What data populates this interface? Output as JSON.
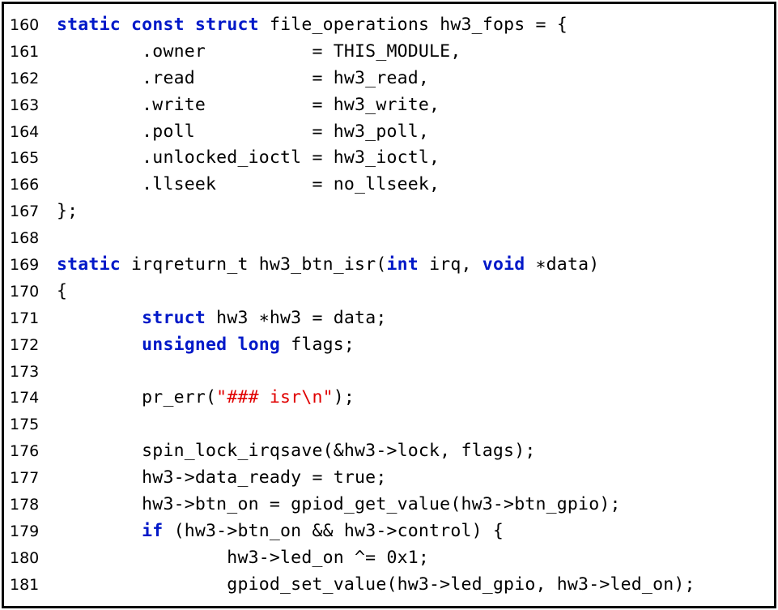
{
  "colors": {
    "keyword": "#0018c8",
    "string": "#e00000",
    "text": "#000000",
    "border": "#000000",
    "background": "#ffffff"
  },
  "lines": [
    {
      "num": "160",
      "tokens": [
        {
          "t": "static",
          "k": "kw"
        },
        {
          "t": " "
        },
        {
          "t": "const",
          "k": "kw"
        },
        {
          "t": " "
        },
        {
          "t": "struct",
          "k": "kw"
        },
        {
          "t": " file_operations hw3_fops = {"
        }
      ]
    },
    {
      "num": "161",
      "tokens": [
        {
          "t": "        .owner          = THIS_MODULE,"
        }
      ]
    },
    {
      "num": "162",
      "tokens": [
        {
          "t": "        .read           = hw3_read,"
        }
      ]
    },
    {
      "num": "163",
      "tokens": [
        {
          "t": "        .write          = hw3_write,"
        }
      ]
    },
    {
      "num": "164",
      "tokens": [
        {
          "t": "        .poll           = hw3_poll,"
        }
      ]
    },
    {
      "num": "165",
      "tokens": [
        {
          "t": "        .unlocked_ioctl = hw3_ioctl,"
        }
      ]
    },
    {
      "num": "166",
      "tokens": [
        {
          "t": "        .llseek         = no_llseek,"
        }
      ]
    },
    {
      "num": "167",
      "tokens": [
        {
          "t": "};"
        }
      ]
    },
    {
      "num": "168",
      "tokens": []
    },
    {
      "num": "169",
      "tokens": [
        {
          "t": "static",
          "k": "kw"
        },
        {
          "t": " irqreturn_t hw3_btn_isr("
        },
        {
          "t": "int",
          "k": "kw"
        },
        {
          "t": " irq, "
        },
        {
          "t": "void",
          "k": "kw"
        },
        {
          "t": " ∗data)"
        }
      ]
    },
    {
      "num": "170",
      "tokens": [
        {
          "t": "{"
        }
      ]
    },
    {
      "num": "171",
      "tokens": [
        {
          "t": "        "
        },
        {
          "t": "struct",
          "k": "kw"
        },
        {
          "t": " hw3 ∗hw3 = data;"
        }
      ]
    },
    {
      "num": "172",
      "tokens": [
        {
          "t": "        "
        },
        {
          "t": "unsigned",
          "k": "kw"
        },
        {
          "t": " "
        },
        {
          "t": "long",
          "k": "kw"
        },
        {
          "t": " flags;"
        }
      ]
    },
    {
      "num": "173",
      "tokens": []
    },
    {
      "num": "174",
      "tokens": [
        {
          "t": "        pr_err("
        },
        {
          "t": "\"### isr\\n\"",
          "k": "str"
        },
        {
          "t": ");"
        }
      ]
    },
    {
      "num": "175",
      "tokens": []
    },
    {
      "num": "176",
      "tokens": [
        {
          "t": "        spin_lock_irqsave(&hw3->lock, flags);"
        }
      ]
    },
    {
      "num": "177",
      "tokens": [
        {
          "t": "        hw3->data_ready = true;"
        }
      ]
    },
    {
      "num": "178",
      "tokens": [
        {
          "t": "        hw3->btn_on = gpiod_get_value(hw3->btn_gpio);"
        }
      ]
    },
    {
      "num": "179",
      "tokens": [
        {
          "t": "        "
        },
        {
          "t": "if",
          "k": "kw"
        },
        {
          "t": " (hw3->btn_on && hw3->control) {"
        }
      ]
    },
    {
      "num": "180",
      "tokens": [
        {
          "t": "                hw3->led_on ^= 0x1;"
        }
      ]
    },
    {
      "num": "181",
      "tokens": [
        {
          "t": "                gpiod_set_value(hw3->led_gpio, hw3->led_on);"
        }
      ]
    }
  ]
}
